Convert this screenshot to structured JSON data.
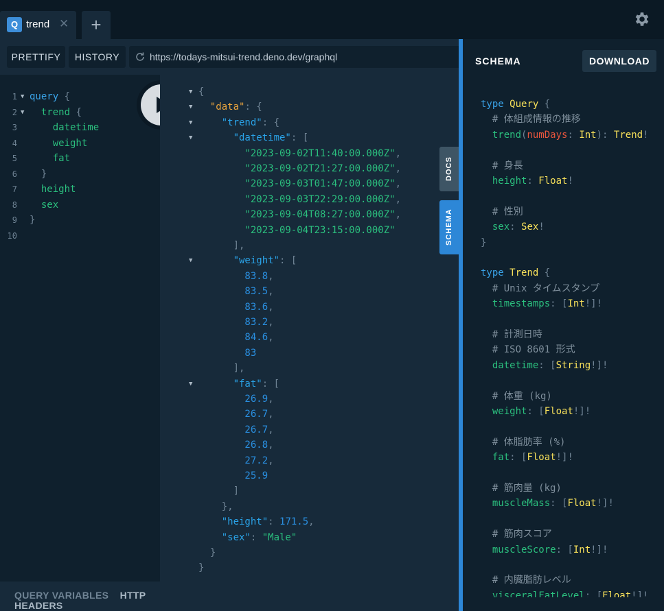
{
  "tabs": {
    "active": {
      "badge": "Q",
      "name": "trend"
    },
    "close_glyph": "✕",
    "add_glyph": "+"
  },
  "toolbar": {
    "prettify": "PRETTIFY",
    "history": "HISTORY",
    "endpoint": "https://todays-mitsui-trend.deno.dev/graphql"
  },
  "query": {
    "line_numbers": [
      "1",
      "2",
      "3",
      "4",
      "5",
      "6",
      "7",
      "8",
      "9",
      "10"
    ],
    "lines": [
      {
        "fold": true,
        "parts": [
          [
            "kw",
            "query"
          ],
          [
            "pun",
            " {"
          ]
        ]
      },
      {
        "fold": true,
        "parts": [
          [
            "fld",
            "  trend"
          ],
          [
            "pun",
            " {"
          ]
        ]
      },
      {
        "fold": false,
        "parts": [
          [
            "fld",
            "    datetime"
          ]
        ]
      },
      {
        "fold": false,
        "parts": [
          [
            "fld",
            "    weight"
          ]
        ]
      },
      {
        "fold": false,
        "parts": [
          [
            "fld",
            "    fat"
          ]
        ]
      },
      {
        "fold": false,
        "parts": [
          [
            "pun",
            "  }"
          ]
        ]
      },
      {
        "fold": false,
        "parts": [
          [
            "fld",
            "  height"
          ]
        ]
      },
      {
        "fold": false,
        "parts": [
          [
            "fld",
            "  sex"
          ]
        ]
      },
      {
        "fold": false,
        "parts": [
          [
            "pun",
            "}"
          ]
        ]
      },
      {
        "fold": false,
        "parts": []
      }
    ]
  },
  "result": {
    "lines": [
      {
        "fold": true,
        "parts": [
          [
            "pun",
            "{"
          ]
        ]
      },
      {
        "fold": true,
        "parts": [
          [
            "rkey",
            "  \"data\""
          ],
          [
            "pun",
            ": {"
          ]
        ]
      },
      {
        "fold": true,
        "parts": [
          [
            "key",
            "    \"trend\""
          ],
          [
            "pun",
            ": {"
          ]
        ]
      },
      {
        "fold": true,
        "parts": [
          [
            "key",
            "      \"datetime\""
          ],
          [
            "pun",
            ": ["
          ]
        ]
      },
      {
        "fold": false,
        "parts": [
          [
            "str",
            "        \"2023-09-02T11:40:00.000Z\""
          ],
          [
            "pun",
            ","
          ]
        ]
      },
      {
        "fold": false,
        "parts": [
          [
            "str",
            "        \"2023-09-02T21:27:00.000Z\""
          ],
          [
            "pun",
            ","
          ]
        ]
      },
      {
        "fold": false,
        "parts": [
          [
            "str",
            "        \"2023-09-03T01:47:00.000Z\""
          ],
          [
            "pun",
            ","
          ]
        ]
      },
      {
        "fold": false,
        "parts": [
          [
            "str",
            "        \"2023-09-03T22:29:00.000Z\""
          ],
          [
            "pun",
            ","
          ]
        ]
      },
      {
        "fold": false,
        "parts": [
          [
            "str",
            "        \"2023-09-04T08:27:00.000Z\""
          ],
          [
            "pun",
            ","
          ]
        ]
      },
      {
        "fold": false,
        "parts": [
          [
            "str",
            "        \"2023-09-04T23:15:00.000Z\""
          ]
        ]
      },
      {
        "fold": false,
        "parts": [
          [
            "pun",
            "      ],"
          ]
        ]
      },
      {
        "fold": true,
        "parts": [
          [
            "key",
            "      \"weight\""
          ],
          [
            "pun",
            ": ["
          ]
        ]
      },
      {
        "fold": false,
        "parts": [
          [
            "num",
            "        83.8"
          ],
          [
            "pun",
            ","
          ]
        ]
      },
      {
        "fold": false,
        "parts": [
          [
            "num",
            "        83.5"
          ],
          [
            "pun",
            ","
          ]
        ]
      },
      {
        "fold": false,
        "parts": [
          [
            "num",
            "        83.6"
          ],
          [
            "pun",
            ","
          ]
        ]
      },
      {
        "fold": false,
        "parts": [
          [
            "num",
            "        83.2"
          ],
          [
            "pun",
            ","
          ]
        ]
      },
      {
        "fold": false,
        "parts": [
          [
            "num",
            "        84.6"
          ],
          [
            "pun",
            ","
          ]
        ]
      },
      {
        "fold": false,
        "parts": [
          [
            "num",
            "        83"
          ]
        ]
      },
      {
        "fold": false,
        "parts": [
          [
            "pun",
            "      ],"
          ]
        ]
      },
      {
        "fold": true,
        "parts": [
          [
            "key",
            "      \"fat\""
          ],
          [
            "pun",
            ": ["
          ]
        ]
      },
      {
        "fold": false,
        "parts": [
          [
            "num",
            "        26.9"
          ],
          [
            "pun",
            ","
          ]
        ]
      },
      {
        "fold": false,
        "parts": [
          [
            "num",
            "        26.7"
          ],
          [
            "pun",
            ","
          ]
        ]
      },
      {
        "fold": false,
        "parts": [
          [
            "num",
            "        26.7"
          ],
          [
            "pun",
            ","
          ]
        ]
      },
      {
        "fold": false,
        "parts": [
          [
            "num",
            "        26.8"
          ],
          [
            "pun",
            ","
          ]
        ]
      },
      {
        "fold": false,
        "parts": [
          [
            "num",
            "        27.2"
          ],
          [
            "pun",
            ","
          ]
        ]
      },
      {
        "fold": false,
        "parts": [
          [
            "num",
            "        25.9"
          ]
        ]
      },
      {
        "fold": false,
        "parts": [
          [
            "pun",
            "      ]"
          ]
        ]
      },
      {
        "fold": false,
        "parts": [
          [
            "pun",
            "    },"
          ]
        ]
      },
      {
        "fold": false,
        "parts": [
          [
            "key",
            "    \"height\""
          ],
          [
            "pun",
            ": "
          ],
          [
            "num",
            "171.5"
          ],
          [
            "pun",
            ","
          ]
        ]
      },
      {
        "fold": false,
        "parts": [
          [
            "key",
            "    \"sex\""
          ],
          [
            "pun",
            ": "
          ],
          [
            "str",
            "\"Male\""
          ]
        ]
      },
      {
        "fold": false,
        "parts": [
          [
            "pun",
            "  }"
          ]
        ]
      },
      {
        "fold": false,
        "parts": [
          [
            "pun",
            "}"
          ]
        ]
      }
    ]
  },
  "side_tabs": {
    "docs": "DOCS",
    "schema": "SCHEMA"
  },
  "bottom": {
    "query_variables": "QUERY VARIABLES",
    "http_headers": "HTTP HEADERS"
  },
  "schema": {
    "title": "SCHEMA",
    "download": "DOWNLOAD",
    "lines": [
      {
        "parts": [
          [
            "kw",
            "type "
          ],
          [
            "tname",
            "Query"
          ],
          [
            "pun",
            " {"
          ]
        ]
      },
      {
        "parts": [
          [
            "cmt",
            "  # 体組成情報の推移"
          ]
        ]
      },
      {
        "parts": [
          [
            "sfld",
            "  trend"
          ],
          [
            "pun",
            "("
          ],
          [
            "arg",
            "numDays"
          ],
          [
            "pun",
            ": "
          ],
          [
            "tname",
            "Int"
          ],
          [
            "pun",
            "): "
          ],
          [
            "tname",
            "Trend"
          ],
          [
            "pun",
            "!"
          ]
        ]
      },
      {
        "parts": []
      },
      {
        "parts": [
          [
            "cmt",
            "  # 身長"
          ]
        ]
      },
      {
        "parts": [
          [
            "sfld",
            "  height"
          ],
          [
            "pun",
            ": "
          ],
          [
            "tname",
            "Float"
          ],
          [
            "pun",
            "!"
          ]
        ]
      },
      {
        "parts": []
      },
      {
        "parts": [
          [
            "cmt",
            "  # 性別"
          ]
        ]
      },
      {
        "parts": [
          [
            "sfld",
            "  sex"
          ],
          [
            "pun",
            ": "
          ],
          [
            "tname",
            "Sex"
          ],
          [
            "pun",
            "!"
          ]
        ]
      },
      {
        "parts": [
          [
            "pun",
            "}"
          ]
        ]
      },
      {
        "parts": []
      },
      {
        "parts": [
          [
            "kw",
            "type "
          ],
          [
            "tname",
            "Trend"
          ],
          [
            "pun",
            " {"
          ]
        ]
      },
      {
        "parts": [
          [
            "cmt",
            "  # Unix タイムスタンプ"
          ]
        ]
      },
      {
        "parts": [
          [
            "sfld",
            "  timestamps"
          ],
          [
            "pun",
            ": ["
          ],
          [
            "tname",
            "Int"
          ],
          [
            "pun",
            "!]!"
          ]
        ]
      },
      {
        "parts": []
      },
      {
        "parts": [
          [
            "cmt",
            "  # 計測日時"
          ]
        ]
      },
      {
        "parts": [
          [
            "cmt",
            "  # ISO 8601 形式"
          ]
        ]
      },
      {
        "parts": [
          [
            "sfld",
            "  datetime"
          ],
          [
            "pun",
            ": ["
          ],
          [
            "tname",
            "String"
          ],
          [
            "pun",
            "!]!"
          ]
        ]
      },
      {
        "parts": []
      },
      {
        "parts": [
          [
            "cmt",
            "  # 体重 (kg)"
          ]
        ]
      },
      {
        "parts": [
          [
            "sfld",
            "  weight"
          ],
          [
            "pun",
            ": ["
          ],
          [
            "tname",
            "Float"
          ],
          [
            "pun",
            "!]!"
          ]
        ]
      },
      {
        "parts": []
      },
      {
        "parts": [
          [
            "cmt",
            "  # 体脂肪率 (%)"
          ]
        ]
      },
      {
        "parts": [
          [
            "sfld",
            "  fat"
          ],
          [
            "pun",
            ": ["
          ],
          [
            "tname",
            "Float"
          ],
          [
            "pun",
            "!]!"
          ]
        ]
      },
      {
        "parts": []
      },
      {
        "parts": [
          [
            "cmt",
            "  # 筋肉量 (kg)"
          ]
        ]
      },
      {
        "parts": [
          [
            "sfld",
            "  muscleMass"
          ],
          [
            "pun",
            ": ["
          ],
          [
            "tname",
            "Float"
          ],
          [
            "pun",
            "!]!"
          ]
        ]
      },
      {
        "parts": []
      },
      {
        "parts": [
          [
            "cmt",
            "  # 筋肉スコア"
          ]
        ]
      },
      {
        "parts": [
          [
            "sfld",
            "  muscleScore"
          ],
          [
            "pun",
            ": ["
          ],
          [
            "tname",
            "Int"
          ],
          [
            "pun",
            "!]!"
          ]
        ]
      },
      {
        "parts": []
      },
      {
        "parts": [
          [
            "cmt",
            "  # 内臓脂肪レベル"
          ]
        ]
      },
      {
        "parts": [
          [
            "sfld",
            "  visceralFatLevel"
          ],
          [
            "pun",
            ": ["
          ],
          [
            "tname",
            "Float"
          ],
          [
            "pun",
            "!]!"
          ]
        ]
      }
    ]
  },
  "colors": {
    "accent": "#2d87d7",
    "background": "#172a3a",
    "editor": "#0f202d"
  },
  "icons": {
    "settings": "gear-icon",
    "reload": "reload-icon",
    "run": "play-icon"
  }
}
